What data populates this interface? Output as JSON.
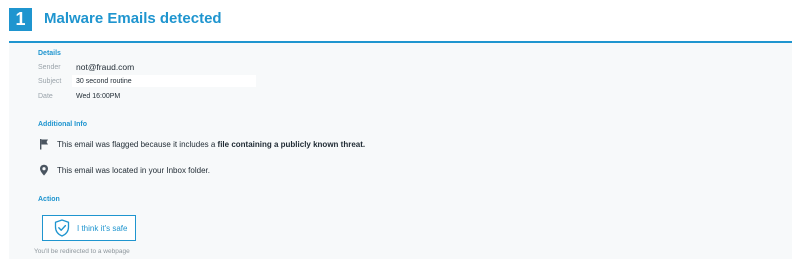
{
  "header": {
    "step": "1",
    "title": "Malware Emails detected"
  },
  "details": {
    "heading": "Details",
    "rows": [
      {
        "label": "Sender",
        "value": "not@fraud.com"
      },
      {
        "label": "Subject",
        "value": "30 second routine"
      },
      {
        "label": "Date",
        "value": "Wed 16:00PM"
      }
    ]
  },
  "additional": {
    "heading": "Additional Info",
    "flag_prefix": "This email was  flagged because it includes a ",
    "flag_bold": "file containing a publicly known threat.",
    "location": "This email was located in your Inbox folder.",
    "icons": [
      "flag-icon",
      "location-pin-icon"
    ]
  },
  "action": {
    "heading": "Action",
    "button_label": "I think it's safe",
    "button_icon": "shield-check-icon",
    "note": "You'll be redirected to a webpage"
  },
  "colors": {
    "accent": "#1f95cf",
    "panel": "#f7f9fa"
  }
}
